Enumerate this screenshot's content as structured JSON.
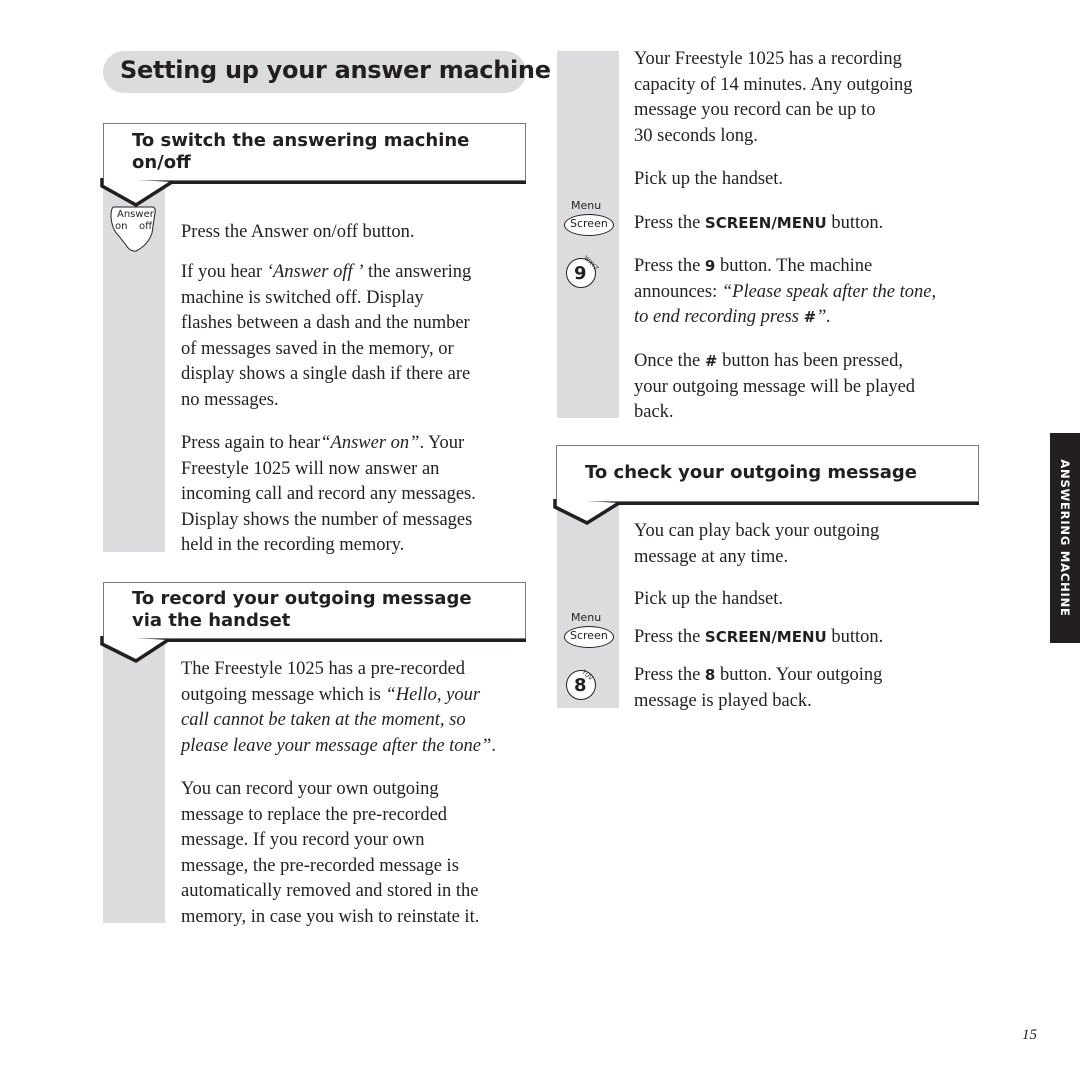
{
  "page": {
    "title": "Setting up your answer machine",
    "side_tab": "ANSWERING MACHINE",
    "page_number": "15"
  },
  "sections": {
    "switch": {
      "heading_line1": "To switch the answering machine",
      "heading_line2": "on/off",
      "icon_label_top": "Answer",
      "icon_label_left": "on",
      "icon_label_right": "off",
      "step1": "Press the Answer on/off button.",
      "p2_lines": [
        [
          "If you hear ",
          "‘Answer off ’",
          " the answering"
        ],
        "machine is switched off. Display",
        "flashes between a dash and the number",
        "of messages saved in the memory, or",
        "display shows a single dash if there are",
        "no messages."
      ],
      "p3_line1_a": "Press again to hear",
      "p3_line1_i": "“Answer on”",
      "p3_line1_b": ". Your",
      "p3_lines": [
        "Freestyle 1025 will now answer an",
        "incoming call and record any messages.",
        "Display shows the number of messages",
        "held in the recording memory."
      ]
    },
    "record": {
      "heading_line1": "To record your outgoing message",
      "heading_line2": "via the handset",
      "p1_line1": "The Freestyle 1025 has a pre-recorded",
      "p1_line2_a": "outgoing message which is ",
      "p1_line2_i": "“Hello, your",
      "p1_line3": "call cannot be taken at the moment, so",
      "p1_line4": "please leave your message after the tone”",
      "p1_line4_end": ".",
      "p2_lines": [
        "You can record your own outgoing",
        "message to replace the pre-recorded",
        "message. If you record your own",
        "message, the pre-recorded message is",
        "automatically removed and stored in the",
        "memory, in case you wish to reinstate it."
      ]
    },
    "record_cont": {
      "p1_lines": [
        "Your Freestyle 1025 has a recording",
        "capacity of 14 minutes. Any outgoing",
        "message you record can be up to",
        "30 seconds long."
      ],
      "step_pickup": "Pick up the handset.",
      "menu_icon_top": "Menu",
      "menu_icon_label": "Screen",
      "step_menu_a": "Press the ",
      "step_menu_b": "SCREEN/MENU",
      "step_menu_c": " button.",
      "key9_digit": "9",
      "key9_letters": "WXYZ",
      "step9_a": "Press the ",
      "step9_b": "9",
      "step9_c": " button. The machine",
      "step9_line2_a": "announces: ",
      "step9_line2_i": "“Please speak after the tone,",
      "step9_line3_i": "to end recording press ",
      "step9_line3_b": "#",
      "step9_line3_end": "”.",
      "hash_line1_a": "Once the ",
      "hash_line1_b": "#",
      "hash_line1_c": " button has been pressed,",
      "hash_line2": "your outgoing message will be played",
      "hash_line3": "back."
    },
    "check": {
      "heading": "To check your outgoing message",
      "p1_lines": [
        "You can play back your outgoing",
        "message at any time."
      ],
      "step_pickup": "Pick up the handset.",
      "menu_icon_top": "Menu",
      "menu_icon_label": "Screen",
      "step_menu_a": "Press the ",
      "step_menu_b": "SCREEN/MENU",
      "step_menu_c": " button.",
      "key8_digit": "8",
      "key8_letters": "TUV",
      "step8_a": "Press the ",
      "step8_b": "8",
      "step8_c": " button. Your outgoing",
      "step8_line2": "message is played back."
    }
  }
}
